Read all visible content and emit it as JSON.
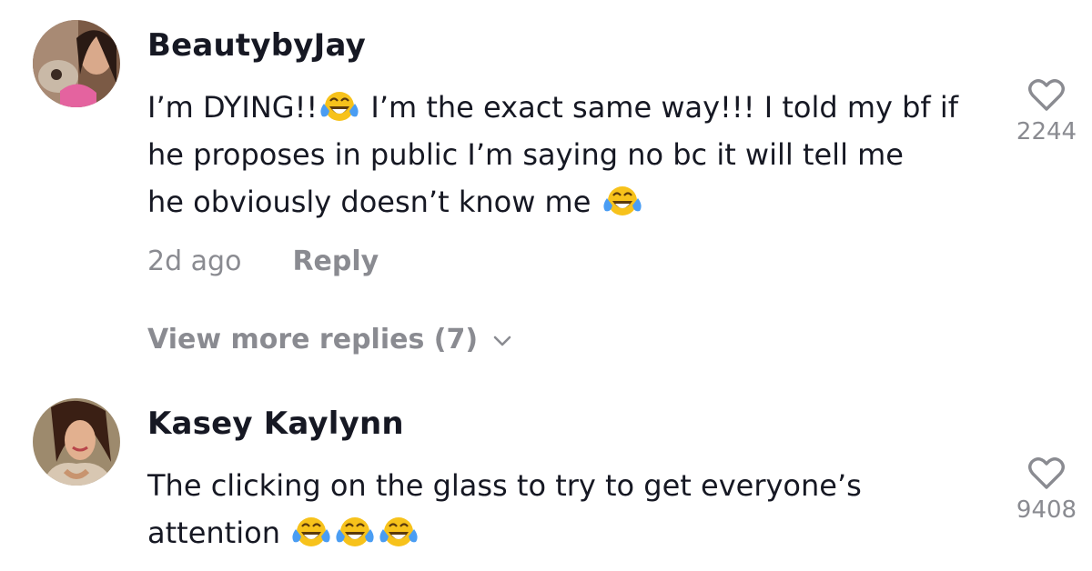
{
  "comments": [
    {
      "username": "BeautybyJay",
      "lines": [
        {
          "a": "I’m DYING!!",
          "b": " I’m the exact same way!!! I told my bf if"
        },
        {
          "a": "he proposes in public I’m saying no bc it will tell me"
        },
        {
          "a": "he obviously doesn’t know me "
        }
      ],
      "time": "2d ago",
      "reply_label": "Reply",
      "view_more": "View more replies (7)",
      "likes": "2244"
    },
    {
      "username": "Kasey Kaylynn",
      "lines": [
        {
          "a": "The clicking on the glass to try to get everyone’s"
        },
        {
          "a": "attention "
        }
      ],
      "likes": "9408"
    }
  ],
  "icons": {
    "like": "heart-outline-icon",
    "emoji": "face-with-tears-of-joy-emoji",
    "expand": "chevron-down-icon"
  },
  "colors": {
    "text": "#161823",
    "muted": "#8a8b91",
    "background": "#ffffff"
  }
}
